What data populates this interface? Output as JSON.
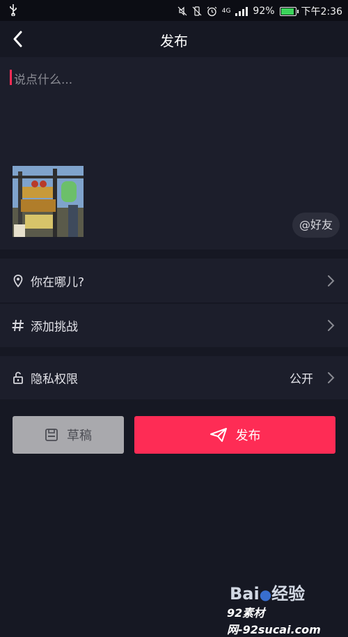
{
  "status_bar": {
    "network": "4G",
    "battery": "92%",
    "battery_level": 0.92,
    "time": "下午2:36",
    "icons": [
      "usb-icon",
      "mute-icon",
      "vibrate-icon",
      "alarm-icon",
      "signal-icon",
      "battery-icon"
    ]
  },
  "header": {
    "title": "发布",
    "back_icon": "chevron-left-icon"
  },
  "compose": {
    "placeholder": "说点什么...",
    "friends_button": "@好友"
  },
  "options": [
    {
      "label": "你在哪儿?",
      "icon": "location-pin-icon"
    },
    {
      "label": "添加挑战",
      "icon": "hashtag-icon"
    },
    {
      "label": "隐私权限",
      "value": "公开",
      "icon": "unlock-icon"
    }
  ],
  "actions": {
    "draft_label": "草稿",
    "publish_label": "发布"
  },
  "watermark": {
    "baidu": "Bai",
    "baidu_jingyan": "经验",
    "sucai": "92素材网-92sucai.com"
  },
  "colors": {
    "background": "#161823",
    "row_background": "#1c1e2b",
    "accent": "#fe2c55",
    "draft_button": "#a9a9ad"
  }
}
